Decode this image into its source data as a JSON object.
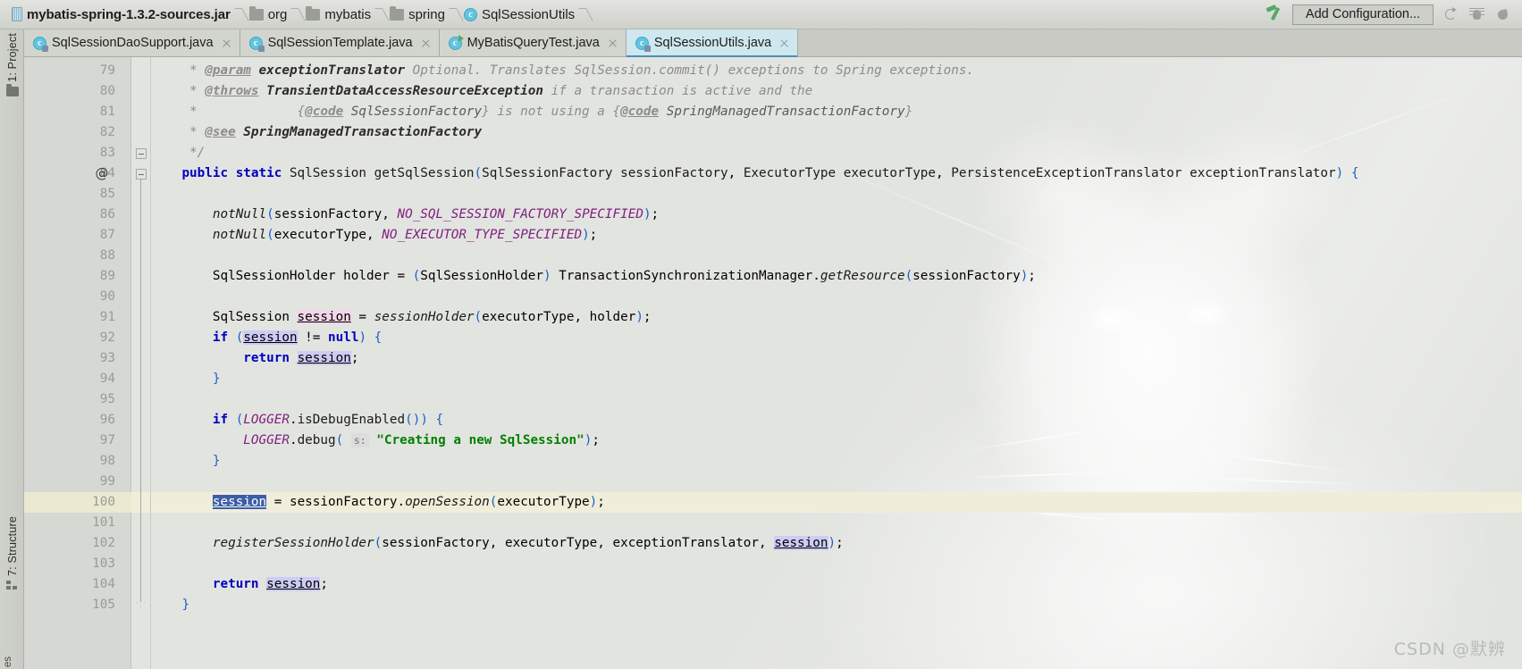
{
  "navbar": {
    "breadcrumb": [
      {
        "label": "mybatis-spring-1.3.2-sources.jar",
        "icon": "jar-icon",
        "bold": true
      },
      {
        "label": "org",
        "icon": "folder-icon",
        "bold": false
      },
      {
        "label": "mybatis",
        "icon": "folder-icon",
        "bold": false
      },
      {
        "label": "spring",
        "icon": "folder-icon",
        "bold": false
      },
      {
        "label": "SqlSessionUtils",
        "icon": "java-class-icon",
        "bold": false
      }
    ],
    "build_icon": "hammer-icon",
    "add_configuration": "Add Configuration...",
    "run_icon": "run-icon",
    "debug_icon": "debug-icon",
    "coverage_icon": "run-with-coverage-icon"
  },
  "tabs": [
    {
      "label": "SqlSessionDaoSupport.java",
      "icon": "java-class-icon",
      "active": false,
      "runnable": false
    },
    {
      "label": "SqlSessionTemplate.java",
      "icon": "java-class-icon",
      "active": false,
      "runnable": false
    },
    {
      "label": "MyBatisQueryTest.java",
      "icon": "java-class-icon",
      "active": false,
      "runnable": true
    },
    {
      "label": "SqlSessionUtils.java",
      "icon": "java-class-icon",
      "active": true,
      "runnable": false
    }
  ],
  "left_rail": {
    "project": "1: Project",
    "project_icon": "folder-icon",
    "structure": "7: Structure",
    "structure_icon": "structure-icon",
    "bottom_label": "es"
  },
  "editor": {
    "first_line": 79,
    "highlighted_line": 100,
    "caret_line": 100,
    "colors": {
      "keyword": "#0000c0",
      "string": "#008000",
      "comment": "#8c8c8c",
      "static_field": "#80207f",
      "selection": "#3b5ea8",
      "occurrence": "#ccccf5",
      "write_occurrence": "#f2d6ea",
      "caret_row": "#f0eedb"
    },
    "lines": [
      {
        "n": 79,
        "text": "     * @param exceptionTranslator Optional. Translates SqlSession.commit() exceptions to Spring exceptions."
      },
      {
        "n": 80,
        "text": "     * @throws TransientDataAccessResourceException if a transaction is active and the"
      },
      {
        "n": 81,
        "text": "     *             {@code SqlSessionFactory} is not using a {@code SpringManagedTransactionFactory}"
      },
      {
        "n": 82,
        "text": "     * @see SpringManagedTransactionFactory"
      },
      {
        "n": 83,
        "text": "     */"
      },
      {
        "n": 84,
        "text": "    public static SqlSession getSqlSession(SqlSessionFactory sessionFactory, ExecutorType executorType, PersistenceExceptionTranslator exceptionTranslator) {"
      },
      {
        "n": 85,
        "text": ""
      },
      {
        "n": 86,
        "text": "        notNull(sessionFactory, NO_SQL_SESSION_FACTORY_SPECIFIED);"
      },
      {
        "n": 87,
        "text": "        notNull(executorType, NO_EXECUTOR_TYPE_SPECIFIED);"
      },
      {
        "n": 88,
        "text": ""
      },
      {
        "n": 89,
        "text": "        SqlSessionHolder holder = (SqlSessionHolder) TransactionSynchronizationManager.getResource(sessionFactory);"
      },
      {
        "n": 90,
        "text": ""
      },
      {
        "n": 91,
        "text": "        SqlSession session = sessionHolder(executorType, holder);"
      },
      {
        "n": 92,
        "text": "        if (session != null) {"
      },
      {
        "n": 93,
        "text": "            return session;"
      },
      {
        "n": 94,
        "text": "        }"
      },
      {
        "n": 95,
        "text": ""
      },
      {
        "n": 96,
        "text": "        if (LOGGER.isDebugEnabled()) {"
      },
      {
        "n": 97,
        "text": "            LOGGER.debug( s: \"Creating a new SqlSession\");"
      },
      {
        "n": 98,
        "text": "        }"
      },
      {
        "n": 99,
        "text": ""
      },
      {
        "n": 100,
        "text": "        session = sessionFactory.openSession(executorType);"
      },
      {
        "n": 101,
        "text": ""
      },
      {
        "n": 102,
        "text": "        registerSessionHolder(sessionFactory, executorType, exceptionTranslator, session);"
      },
      {
        "n": 103,
        "text": ""
      },
      {
        "n": 104,
        "text": "        return session;"
      },
      {
        "n": 105,
        "text": "    }"
      }
    ],
    "parameter_hint": "s:",
    "gutter_annotation_line": 84,
    "gutter_annotation_symbol": "@"
  },
  "watermark": "CSDN @默辨"
}
